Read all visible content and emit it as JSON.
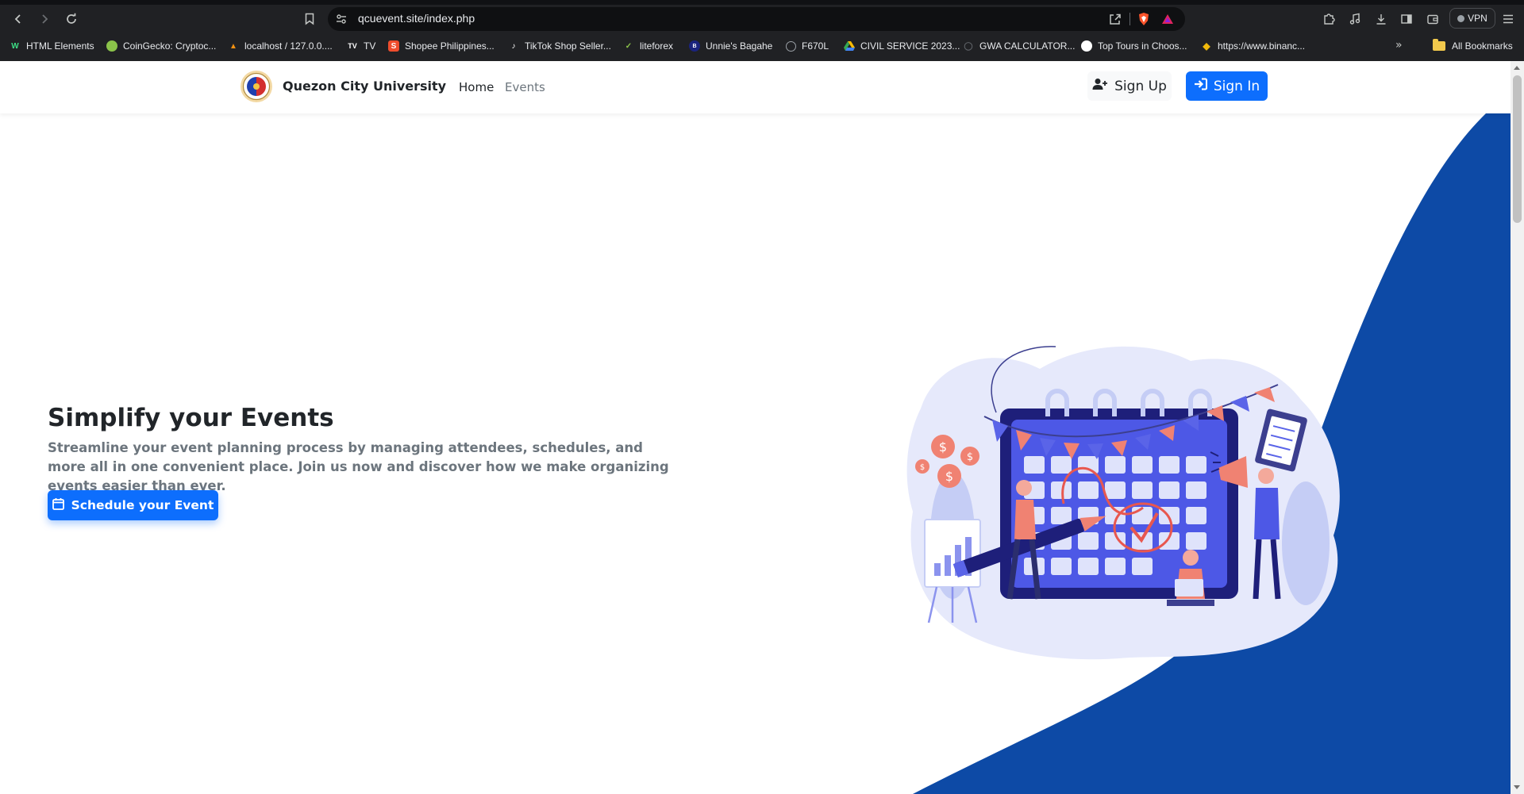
{
  "browser": {
    "url": "qcuevent.site/index.php",
    "vpn_label": "VPN",
    "bookmarks": [
      {
        "label": "HTML Elements",
        "icon": "html-elements-favicon",
        "color": "#2e7d32"
      },
      {
        "label": "CoinGecko: Cryptoc...",
        "icon": "coingecko-favicon",
        "color": "#8bc34a"
      },
      {
        "label": "localhost / 127.0.0....",
        "icon": "phpmyadmin-favicon",
        "color": "#f29111"
      },
      {
        "label": "TV",
        "icon": "tradingview-favicon",
        "color": "#ffffff"
      },
      {
        "label": "Shopee Philippines...",
        "icon": "shopee-favicon",
        "color": "#ee4d2d"
      },
      {
        "label": "TikTok Shop Seller...",
        "icon": "tiktok-favicon",
        "color": "#ffffff"
      },
      {
        "label": "liteforex",
        "icon": "liteforex-favicon",
        "color": "#8bc34a"
      },
      {
        "label": "Unnie's Bagahe",
        "icon": "unnies-bagahe-favicon",
        "color": "#3949ab"
      },
      {
        "label": "F670L",
        "icon": "globe-icon",
        "color": "#9aa0a6"
      },
      {
        "label": "CIVIL SERVICE 2023...",
        "icon": "google-drive-favicon",
        "color": "#34a853"
      },
      {
        "label": "GWA CALCULATOR...",
        "icon": "shield-favicon",
        "color": "#5f6368"
      },
      {
        "label": "Top Tours in Choos...",
        "icon": "top-tours-favicon",
        "color": "#ffffff"
      },
      {
        "label": "https://www.binanc...",
        "icon": "binance-favicon",
        "color": "#f0b90b"
      }
    ],
    "all_bookmarks_label": "All Bookmarks"
  },
  "navbar": {
    "brand": "Quezon City University",
    "links": [
      "Home",
      "Events"
    ],
    "signup_label": "Sign Up",
    "signin_label": "Sign In"
  },
  "hero": {
    "title": "Simplify your Events",
    "description": "Streamline your event planning process by managing attendees, schedules, and more all in one convenient place. Join us now and discover how we make organizing events easier than ever.",
    "button_label": "Schedule your Event"
  },
  "colors": {
    "primary": "#0d6efd",
    "wave": "#0d4aa6",
    "chrome": "#202124"
  }
}
